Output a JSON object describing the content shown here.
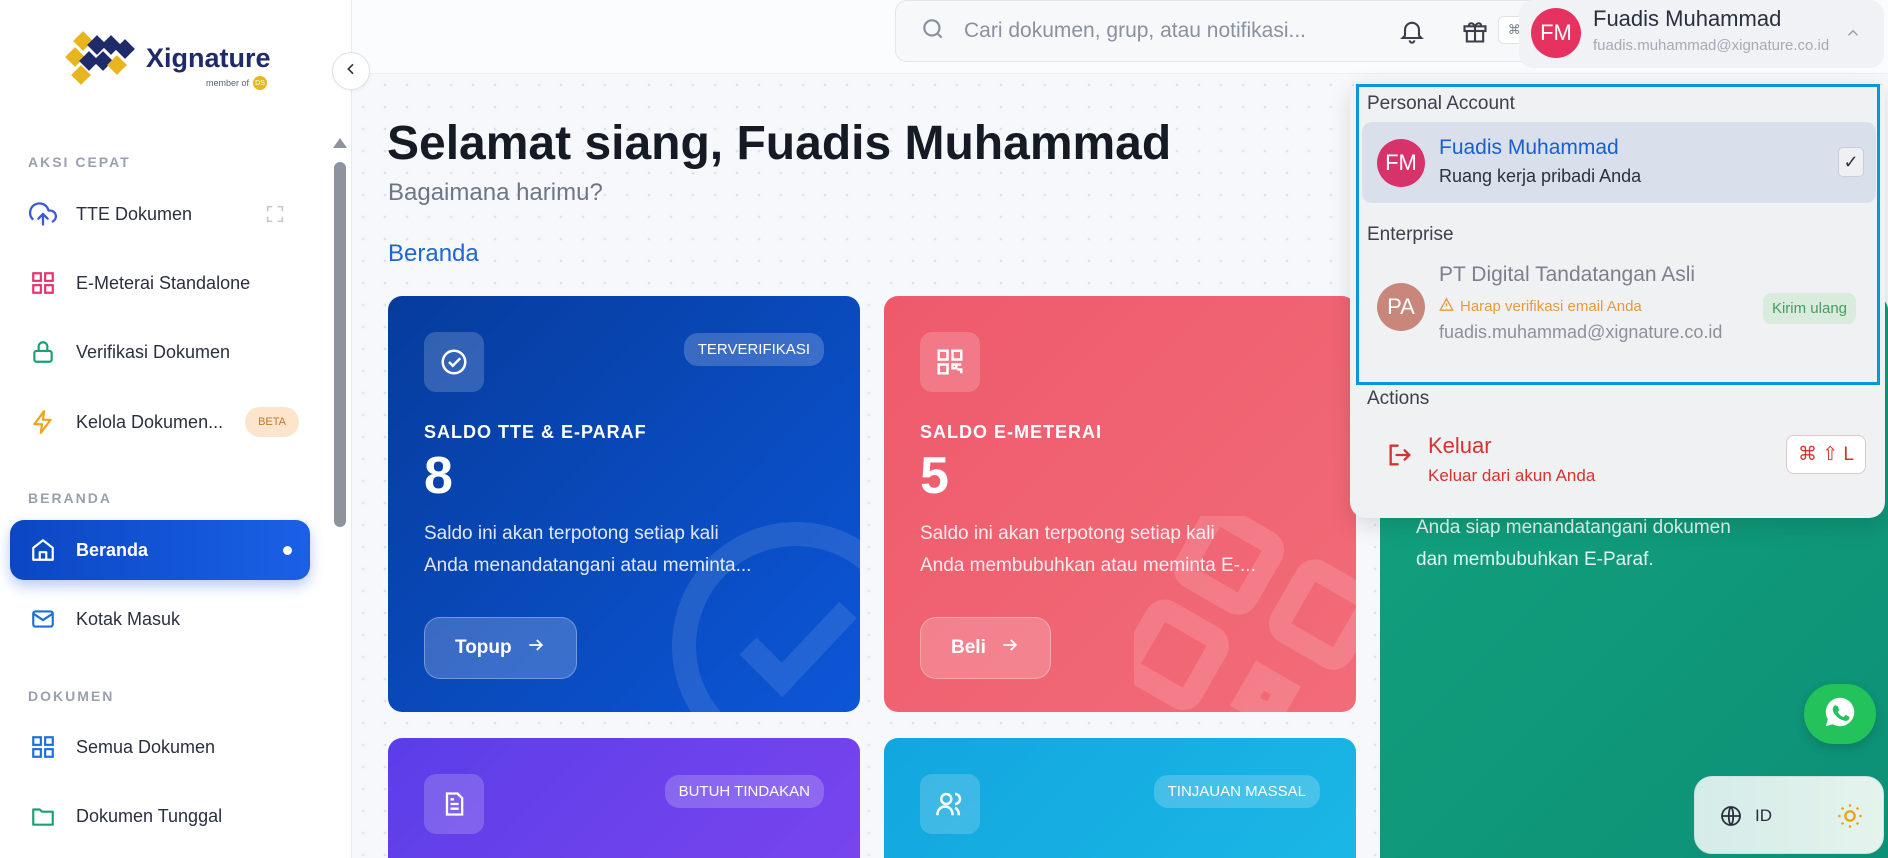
{
  "brand": {
    "name": "Xignature",
    "member_of": "member of",
    "member_badge": "DS"
  },
  "search": {
    "placeholder": "Cari dokumen, grup, atau notifikasi...",
    "shortcut": "⌘ K"
  },
  "user": {
    "initials": "FM",
    "name": "Fuadis Muhammad",
    "email": "fuadis.muhammad@xignature.co.id"
  },
  "sidebar": {
    "sections": [
      {
        "title": "AKSI CEPAT"
      },
      {
        "title": "BERANDA"
      },
      {
        "title": "DOKUMEN"
      }
    ],
    "items": [
      {
        "label": "TTE Dokumen",
        "icon": "upload-cloud-icon"
      },
      {
        "label": "E-Meterai Standalone",
        "icon": "grid-icon"
      },
      {
        "label": "Verifikasi Dokumen",
        "icon": "lock-icon"
      },
      {
        "label": "Kelola Dokumen...",
        "icon": "bolt-icon",
        "badge": "BETA"
      },
      {
        "label": "Beranda",
        "icon": "home-icon",
        "active": true
      },
      {
        "label": "Kotak Masuk",
        "icon": "mail-icon"
      },
      {
        "label": "Semua Dokumen",
        "icon": "grid-icon"
      },
      {
        "label": "Dokumen Tunggal",
        "icon": "folder-icon"
      }
    ]
  },
  "main": {
    "greeting": "Selamat siang, Fuadis Muhammad",
    "subtitle": "Bagaimana harimu?",
    "section_title": "Beranda",
    "cards": [
      {
        "badge": "TERVERIFIKASI",
        "label": "SALDO TTE & E-PARAF",
        "value": "8",
        "desc_line1": "Saldo ini akan terpotong setiap kali",
        "desc_line2": "Anda menandatangani atau meminta...",
        "cta": "Topup",
        "color": "#0a4bd0"
      },
      {
        "badge": "",
        "label": "SALDO E-METERAI",
        "value": "5",
        "desc_line1": "Saldo ini akan terpotong setiap kali",
        "desc_line2": "Anda membubuhkan atau meminta E-...",
        "cta": "Beli",
        "color": "#f0606f"
      },
      {
        "desc_line1": "Anda siap menandatangani dokumen",
        "desc_line2": "dan membubuhkan E-Paraf.",
        "color": "#0f9a7c"
      },
      {
        "badge": "BUTUH TINDAKAN",
        "color": "#6a3fe8"
      },
      {
        "badge": "TINJAUAN MASSAL",
        "color": "#16b0e0"
      }
    ]
  },
  "dropdown": {
    "personal_title": "Personal Account",
    "personal": {
      "initials": "FM",
      "name": "Fuadis Muhammad",
      "subtitle": "Ruang kerja pribadi Anda",
      "check": "✓"
    },
    "enterprise_title": "Enterprise",
    "enterprise": {
      "initials": "PA",
      "name": "PT Digital Tandatangan Asli",
      "warning": "Harap verifikasi email Anda",
      "email": "fuadis.muhammad@xignature.co.id",
      "action": "Kirim ulang"
    },
    "actions_title": "Actions",
    "logout": {
      "label": "Keluar",
      "subtitle": "Keluar dari akun Anda",
      "shortcut": "⌘ ⇧ L"
    }
  },
  "language": {
    "code": "ID"
  }
}
